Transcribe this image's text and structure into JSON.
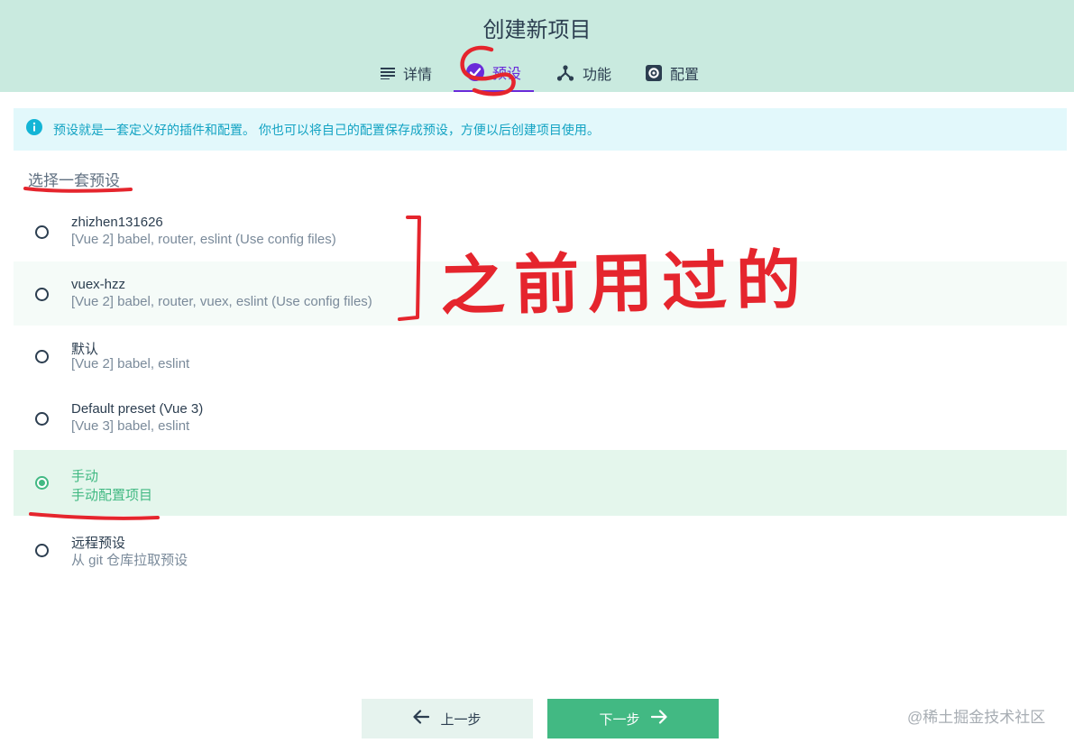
{
  "header": {
    "title": "创建新项目",
    "tabs": [
      {
        "label": "详情",
        "icon": "list-icon"
      },
      {
        "label": "预设",
        "icon": "check-circle-icon",
        "active": true
      },
      {
        "label": "功能",
        "icon": "branch-icon"
      },
      {
        "label": "配置",
        "icon": "gear-icon"
      }
    ]
  },
  "info": {
    "icon": "info-icon",
    "text": "预设就是一套定义好的插件和配置。 你也可以将自己的配置保存成预设，方便以后创建项目使用。"
  },
  "section_title": "选择一套预设",
  "presets": [
    {
      "name": "zhizhen131626",
      "desc": "[Vue 2] babel, router, eslint (Use config files)"
    },
    {
      "name": "vuex-hzz",
      "desc": "[Vue 2] babel, router, vuex, eslint (Use config files)"
    },
    {
      "name": "默认",
      "desc": "[Vue 2] babel, eslint"
    },
    {
      "name": "Default preset (Vue 3)",
      "desc": "[Vue 3] babel, eslint"
    },
    {
      "name": "手动",
      "desc": "手动配置项目",
      "selected": true
    },
    {
      "name": "远程预设",
      "desc": "从 git 仓库拉取预设"
    }
  ],
  "buttons": {
    "prev": "上一步",
    "next": "下一步"
  },
  "annotation": {
    "handwritten": "之前用过的"
  },
  "watermark": "@稀土掘金技术社区",
  "colors": {
    "header_bg": "#c9eadf",
    "accent_green": "#42b983",
    "active_tab": "#6a2bd9",
    "info_bg": "#e2f8fb",
    "info_text": "#13a3c3",
    "annotation_red": "#e5252d"
  }
}
